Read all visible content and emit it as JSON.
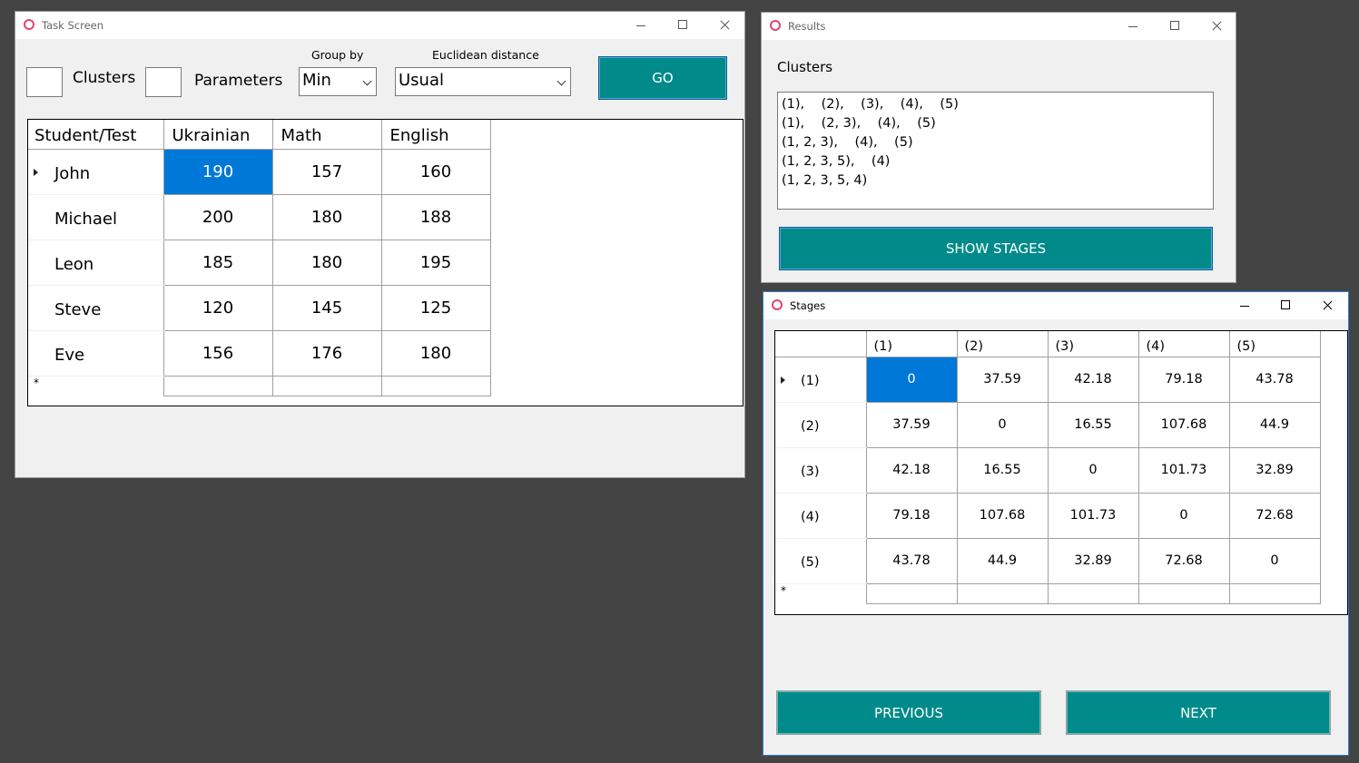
{
  "task_window": {
    "title": "Task Screen",
    "clusters_label": "Clusters",
    "clusters_value": "",
    "parameters_label": "Parameters",
    "parameters_value": "",
    "group_by_label": "Group by",
    "group_by_value": "Min",
    "distance_label": "Euclidean distance",
    "distance_value": "Usual",
    "go_label": "GO",
    "grid": {
      "columns": [
        "Student/Test",
        "Ukrainian",
        "Math",
        "English"
      ],
      "rows": [
        {
          "name": "John",
          "values": [
            "190",
            "157",
            "160"
          ]
        },
        {
          "name": "Michael",
          "values": [
            "200",
            "180",
            "188"
          ]
        },
        {
          "name": "Leon",
          "values": [
            "185",
            "180",
            "195"
          ]
        },
        {
          "name": "Steve",
          "values": [
            "120",
            "145",
            "125"
          ]
        },
        {
          "name": "Eve",
          "values": [
            "156",
            "176",
            "180"
          ]
        }
      ],
      "new_row_marker": "*"
    }
  },
  "results_window": {
    "title": "Results",
    "clusters_label": "Clusters",
    "stages_text": [
      "(1),    (2),    (3),    (4),    (5)",
      "(1),    (2, 3),    (4),    (5)",
      "(1, 2, 3),    (4),    (5)",
      "(1, 2, 3, 5),    (4)",
      "(1, 2, 3, 5, 4)"
    ],
    "show_stages_label": "SHOW STAGES"
  },
  "stages_window": {
    "title": "Stages",
    "grid": {
      "columns": [
        "",
        "(1)",
        "(2)",
        "(3)",
        "(4)",
        "(5)"
      ],
      "rows": [
        {
          "name": "(1)",
          "values": [
            "0",
            "37.59",
            "42.18",
            "79.18",
            "43.78"
          ]
        },
        {
          "name": "(2)",
          "values": [
            "37.59",
            "0",
            "16.55",
            "107.68",
            "44.9"
          ]
        },
        {
          "name": "(3)",
          "values": [
            "42.18",
            "16.55",
            "0",
            "101.73",
            "32.89"
          ]
        },
        {
          "name": "(4)",
          "values": [
            "79.18",
            "107.68",
            "101.73",
            "0",
            "72.68"
          ]
        },
        {
          "name": "(5)",
          "values": [
            "43.78",
            "44.9",
            "32.89",
            "72.68",
            "0"
          ]
        }
      ],
      "new_row_marker": "*"
    },
    "previous_label": "PREVIOUS",
    "next_label": "NEXT"
  }
}
